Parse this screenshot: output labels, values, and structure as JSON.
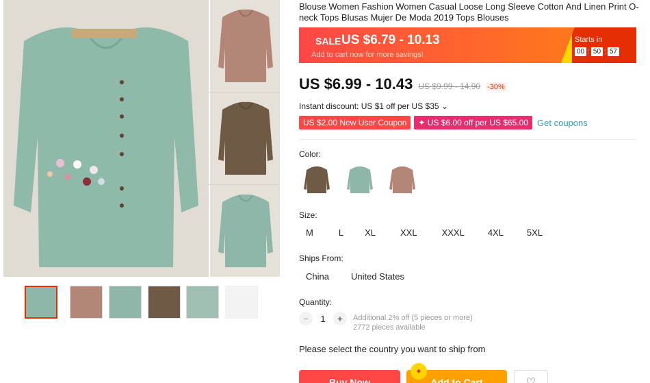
{
  "product": {
    "title": "Blouse Women Fashion Women Casual Loose Long Sleeve Cotton And Linen Print O-neck Tops Blusas Mujer De Moda 2019 Tops Blouses"
  },
  "sale_banner": {
    "tag": "SALE",
    "price": "US $6.79 - 10.13",
    "subtext": "Add to cart now for more savings!",
    "starts_label": "Starts in",
    "timer": [
      "00",
      "50",
      "57"
    ]
  },
  "price": {
    "current": "US $6.99 - 10.43",
    "original": "US $9.99 - 14.90",
    "discount": "-30%"
  },
  "instant_discount": "Instant discount: US $1 off per US $35 ⌄",
  "coupons": {
    "new_user": "US $2.00 New User Coupon",
    "off": "✦ US $6.00 off per US $65.00",
    "get": "Get coupons"
  },
  "color": {
    "label": "Color:",
    "swatches": [
      {
        "name": "brown",
        "color": "#6e5a45"
      },
      {
        "name": "green",
        "color": "#8fb7a9"
      },
      {
        "name": "pink",
        "color": "#b48677"
      }
    ]
  },
  "size": {
    "label": "Size:",
    "options": [
      "M",
      "L",
      "XL",
      "XXL",
      "XXXL",
      "4XL",
      "5XL"
    ]
  },
  "ships_from": {
    "label": "Ships From:",
    "options": [
      "China",
      "United States"
    ]
  },
  "quantity": {
    "label": "Quantity:",
    "minus": "−",
    "value": "1",
    "plus": "+",
    "note_line1": "Additional 2% off (5 pieces or more)",
    "note_line2": "2772 pieces available"
  },
  "ship_message": "Please select the country you want to ship from",
  "actions": {
    "buy_now": "Buy Now",
    "add_to_cart": "Add to Cart",
    "wishlist_icon": "heart-icon"
  },
  "colors": {
    "accent": "#ff4747",
    "cart": "#ffa000",
    "link": "#2e9cc3"
  }
}
